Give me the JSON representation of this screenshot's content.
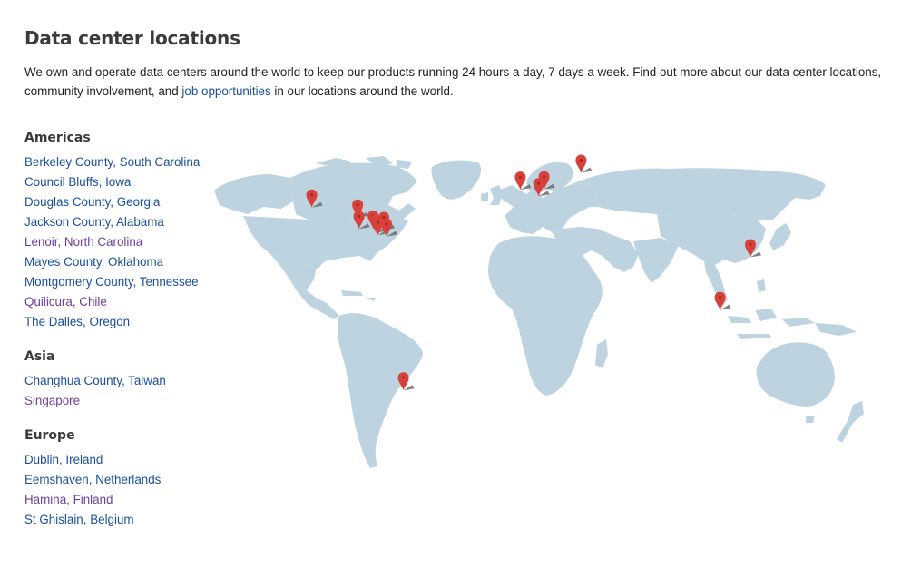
{
  "page": {
    "title": "Data center locations",
    "intro": {
      "before_link": "We own and operate data centers around the world to keep our products running 24 hours a day, 7 days a week. Find out more about our data center locations, community involvement, and ",
      "link_text": "job opportunities",
      "after_link": " in our locations around the world."
    }
  },
  "regions": [
    {
      "name": "Americas",
      "locations": [
        {
          "label": "Berkeley County, South Carolina",
          "visited": false
        },
        {
          "label": "Council Bluffs, Iowa",
          "visited": false
        },
        {
          "label": "Douglas County, Georgia",
          "visited": false
        },
        {
          "label": "Jackson County, Alabama",
          "visited": false
        },
        {
          "label": "Lenoir, North Carolina",
          "visited": true
        },
        {
          "label": "Mayes County, Oklahoma",
          "visited": false
        },
        {
          "label": "Montgomery County, Tennessee",
          "visited": false
        },
        {
          "label": "Quilicura, Chile",
          "visited": true
        },
        {
          "label": "The Dalles, Oregon",
          "visited": false
        }
      ]
    },
    {
      "name": "Asia",
      "locations": [
        {
          "label": "Changhua County, Taiwan",
          "visited": false
        },
        {
          "label": "Singapore",
          "visited": true
        }
      ]
    },
    {
      "name": "Europe",
      "locations": [
        {
          "label": "Dublin, Ireland",
          "visited": false
        },
        {
          "label": "Eemshaven, Netherlands",
          "visited": false
        },
        {
          "label": "Hamina, Finland",
          "visited": true
        },
        {
          "label": "St Ghislain, Belgium",
          "visited": false
        }
      ]
    }
  ],
  "colors": {
    "link": "#1a4f9c",
    "visited_link": "#6b3f99",
    "land": "#bdd3e0",
    "pin": "#d8403b"
  },
  "map": {
    "pin_icon": "map-marker-icon",
    "markers": [
      {
        "label": "The Dalles, Oregon",
        "lon": -121.2,
        "lat": 45.6
      },
      {
        "label": "Council Bluffs, Iowa",
        "lon": -95.9,
        "lat": 41.3
      },
      {
        "label": "Mayes County, Oklahoma",
        "lon": -95.2,
        "lat": 36.3
      },
      {
        "label": "Montgomery County, Tennessee",
        "lon": -87.4,
        "lat": 36.5
      },
      {
        "label": "Jackson County, Alabama",
        "lon": -85.9,
        "lat": 34.7
      },
      {
        "label": "Douglas County, Georgia",
        "lon": -84.7,
        "lat": 33.7
      },
      {
        "label": "Lenoir, North Carolina",
        "lon": -81.5,
        "lat": 35.9
      },
      {
        "label": "Berkeley County, South Carolina",
        "lon": -80.0,
        "lat": 33.1
      },
      {
        "label": "Quilicura, Chile",
        "lon": -70.7,
        "lat": -33.4
      },
      {
        "label": "Dublin, Ireland",
        "lon": -6.3,
        "lat": 53.3
      },
      {
        "label": "St Ghislain, Belgium",
        "lon": 3.8,
        "lat": 50.5
      },
      {
        "label": "Eemshaven, Netherlands",
        "lon": 6.8,
        "lat": 53.4
      },
      {
        "label": "Hamina, Finland",
        "lon": 27.2,
        "lat": 60.6
      },
      {
        "label": "Changhua County, Taiwan",
        "lon": 120.5,
        "lat": 24.1
      },
      {
        "label": "Singapore",
        "lon": 103.8,
        "lat": 1.35
      }
    ]
  }
}
